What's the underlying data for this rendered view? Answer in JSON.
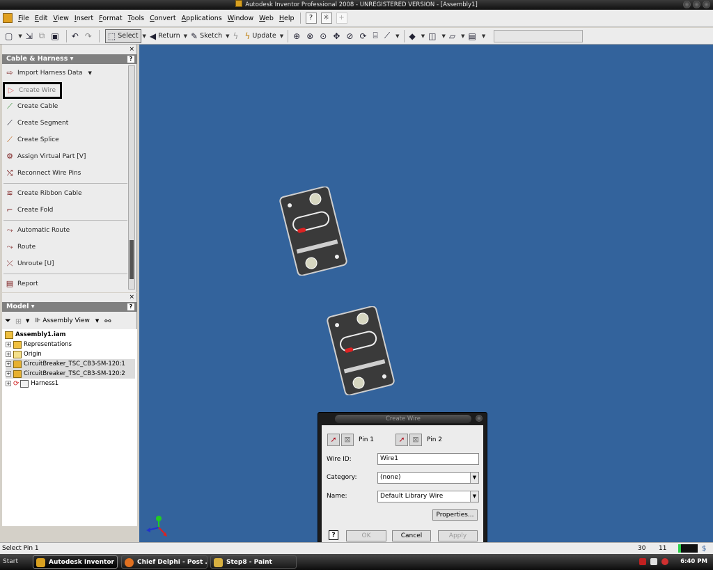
{
  "window": {
    "title": "Autodesk Inventor Professional 2008 - UNREGISTERED VERSION - [Assembly1]"
  },
  "menubar": {
    "items": [
      "File",
      "Edit",
      "View",
      "Insert",
      "Format",
      "Tools",
      "Convert",
      "Applications",
      "Window",
      "Web",
      "Help"
    ]
  },
  "toolbar": {
    "select_label": "Select",
    "return_label": "Return",
    "sketch_label": "Sketch",
    "update_label": "Update"
  },
  "cable_panel": {
    "title": "Cable & Harness",
    "commands": [
      {
        "label": "Import Harness Data",
        "icon": "import-icon"
      },
      {
        "label": "Create Wire",
        "icon": "wire-icon"
      },
      {
        "label": "Create Cable",
        "icon": "cable-icon"
      },
      {
        "label": "Create Segment",
        "icon": "segment-icon"
      },
      {
        "label": "Create Splice",
        "icon": "splice-icon"
      },
      {
        "label": "Assign Virtual Part   [V]",
        "icon": "virtual-part-icon"
      },
      {
        "label": "Reconnect Wire Pins",
        "icon": "reconnect-icon"
      },
      {
        "label": "Create Ribbon Cable",
        "icon": "ribbon-cable-icon"
      },
      {
        "label": "Create Fold",
        "icon": "fold-icon"
      },
      {
        "label": "Automatic Route",
        "icon": "auto-route-icon"
      },
      {
        "label": "Route",
        "icon": "route-icon"
      },
      {
        "label": "Unroute   [U]",
        "icon": "unroute-icon"
      },
      {
        "label": "Report",
        "icon": "report-icon"
      }
    ]
  },
  "model_panel": {
    "title": "Model",
    "view_label": "Assembly View",
    "tree": [
      {
        "label": "Assembly1.iam"
      },
      {
        "label": "Representations"
      },
      {
        "label": "Origin"
      },
      {
        "label": "CircuitBreaker_TSC_CB3-SM-120:1"
      },
      {
        "label": "CircuitBreaker_TSC_CB3-SM-120:2"
      },
      {
        "label": "Harness1"
      }
    ]
  },
  "dialog": {
    "title": "Create Wire",
    "pin1_label": "Pin 1",
    "pin2_label": "Pin 2",
    "wire_id_label": "Wire ID:",
    "wire_id_value": "Wire1",
    "category_label": "Category:",
    "category_value": "(none)",
    "name_label": "Name:",
    "name_value": "Default Library Wire",
    "properties_button": "Properties...",
    "ok_button": "OK",
    "cancel_button": "Cancel",
    "apply_button": "Apply"
  },
  "statusbar": {
    "message": "Select Pin 1",
    "value1": "30",
    "value2": "11"
  },
  "taskbar": {
    "start_label": "Start",
    "tasks": [
      {
        "label": "Autodesk Inventor ...",
        "active": true
      },
      {
        "label": "Chief Delphi - Post ...",
        "active": false
      },
      {
        "label": "Step8 - Paint",
        "active": false
      }
    ],
    "clock": "6:40 PM"
  },
  "colors": {
    "viewport_background": "#33639c",
    "panel_header": "#808080"
  }
}
